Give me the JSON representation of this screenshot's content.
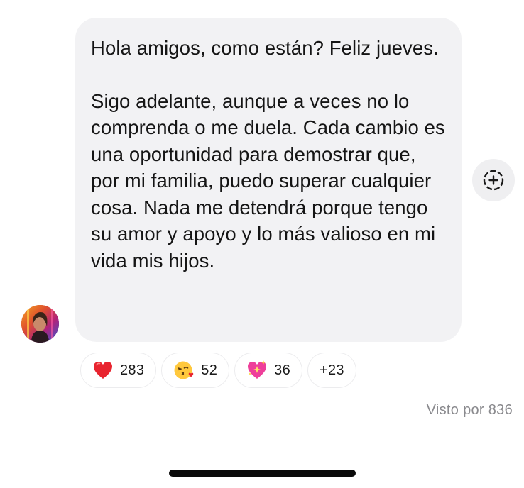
{
  "message": {
    "paragraph1": "Hola amigos, como están? Feliz jueves.",
    "paragraph2": "Sigo adelante, aunque a veces no lo comprenda o me duela. Cada cambio es una oportunidad para demostrar que, por mi familia, puedo superar cualquier cosa. Nada me detendrá porque tengo su amor y apoyo y lo más valioso en mi vida mis hijos."
  },
  "reactions": [
    {
      "emoji": "red-heart",
      "count": "283"
    },
    {
      "emoji": "face-blowing-kiss",
      "count": "52"
    },
    {
      "emoji": "sparkling-heart",
      "count": "36"
    },
    {
      "label": "+23"
    }
  ],
  "seen_text": "Visto por 836",
  "icons": {
    "add_reaction": "add-reaction-icon",
    "avatar": "sender-avatar"
  },
  "colors": {
    "bubble": "#f2f2f4",
    "seen_text": "#8a8a8e",
    "heart": "#e8242f"
  }
}
